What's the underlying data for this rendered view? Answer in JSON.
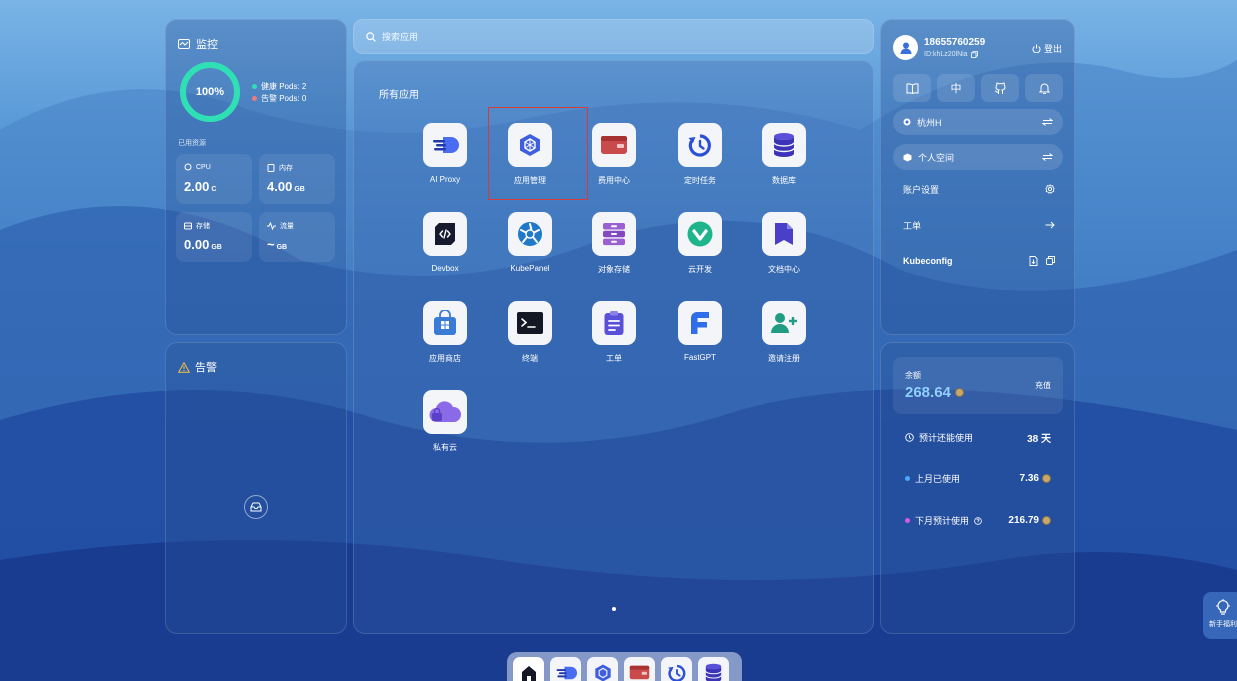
{
  "monitor": {
    "title": "监控",
    "health_percent": 100,
    "health_percent_text": "100%",
    "healthy_pods": "健康 Pods: 2",
    "alert_pods": "告警 Pods: 0",
    "used_resources_label": "已用资源",
    "cpu": {
      "label": "CPU",
      "value": "2.00",
      "unit": "C"
    },
    "memory": {
      "label": "内存",
      "value": "4.00",
      "unit": "GB"
    },
    "storage": {
      "label": "存储",
      "value": "0.00",
      "unit": "GB"
    },
    "traffic": {
      "label": "流量",
      "value": "~",
      "unit": "GB"
    },
    "colors": {
      "ring": "#2fe0b4",
      "healthy": "#2fe0b4",
      "alert": "#f07a7a"
    }
  },
  "alerts": {
    "title": "告警"
  },
  "search": {
    "placeholder": "搜索应用"
  },
  "apps": {
    "title": "所有应用",
    "items": [
      {
        "name": "AI Proxy",
        "icon": "ai-proxy-icon"
      },
      {
        "name": "应用管理",
        "icon": "app-manage-icon"
      },
      {
        "name": "费用中心",
        "icon": "wallet-icon"
      },
      {
        "name": "定时任务",
        "icon": "cron-icon"
      },
      {
        "name": "数据库",
        "icon": "database-icon"
      },
      {
        "name": "Devbox",
        "icon": "devbox-icon"
      },
      {
        "name": "KubePanel",
        "icon": "kubepanel-icon"
      },
      {
        "name": "对象存储",
        "icon": "object-storage-icon"
      },
      {
        "name": "云开发",
        "icon": "cloud-dev-icon"
      },
      {
        "name": "文档中心",
        "icon": "docs-icon"
      },
      {
        "name": "应用商店",
        "icon": "app-store-icon"
      },
      {
        "name": "终端",
        "icon": "terminal-icon"
      },
      {
        "name": "工单",
        "icon": "ticket-icon"
      },
      {
        "name": "FastGPT",
        "icon": "fastgpt-icon"
      },
      {
        "name": "邀请注册",
        "icon": "invite-icon"
      },
      {
        "name": "私有云",
        "icon": "private-cloud-icon"
      }
    ]
  },
  "account": {
    "phone": "18655760259",
    "id": "ID:khLz20lNia",
    "logout": "登出",
    "language_button": "中",
    "region": "杭州H",
    "workspace": "个人空间",
    "settings": "账户设置",
    "ticket": "工单",
    "kubeconfig": "Kubeconfig"
  },
  "balance": {
    "label": "余额",
    "value": "268.64",
    "recharge": "充值",
    "days_label": "预计还能使用",
    "days_value": "38 天",
    "last_month_label": "上月已使用",
    "last_month_value": "7.36",
    "next_month_label": "下月预计使用",
    "next_month_value": "216.79",
    "colors": {
      "value": "#8fd0ff",
      "last_month_dot": "#4aa8ff",
      "next_month_dot": "#d65ae8"
    }
  },
  "guide": {
    "label": "新手福利"
  }
}
